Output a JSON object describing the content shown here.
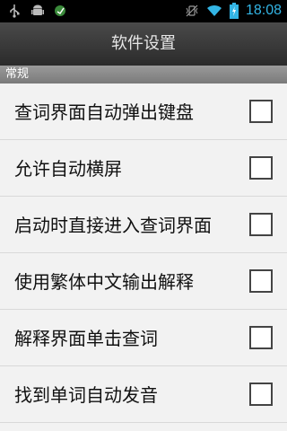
{
  "status_bar": {
    "time": "18:08",
    "left_icons": [
      "usb-icon",
      "android-debug-icon",
      "app-notification-icon"
    ],
    "right_icons": [
      "vibrate-icon",
      "wifi-icon",
      "battery-charging-icon"
    ]
  },
  "title_bar": {
    "title": "软件设置"
  },
  "sections": [
    {
      "header": "常规",
      "items": [
        {
          "label": "查词界面自动弹出键盘",
          "checked": false
        },
        {
          "label": "允许自动横屏",
          "checked": false
        },
        {
          "label": "启动时直接进入查词界面",
          "checked": false
        },
        {
          "label": "使用繁体中文输出解释",
          "checked": false
        },
        {
          "label": "解释界面单击查词",
          "checked": false
        },
        {
          "label": "找到单词自动发音",
          "checked": false
        }
      ]
    }
  ]
}
